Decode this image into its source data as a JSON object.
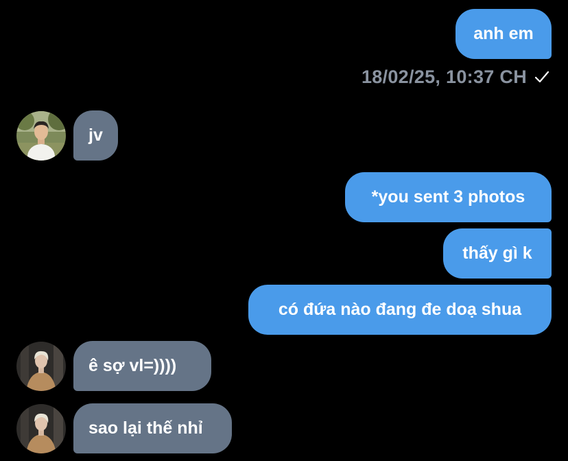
{
  "thread": {
    "messages": [
      {
        "id": "m1",
        "direction": "sent",
        "text": "anh em"
      },
      {
        "id": "m2",
        "direction": "received",
        "text": "jv"
      },
      {
        "id": "m3",
        "direction": "sent",
        "text": "*you sent 3 photos"
      },
      {
        "id": "m4",
        "direction": "sent",
        "text": "thấy gì k"
      },
      {
        "id": "m5",
        "direction": "sent",
        "text": "có đứa nào đang đe doạ shua"
      },
      {
        "id": "m6",
        "direction": "received",
        "text": "ê sợ vl=))))"
      },
      {
        "id": "m7",
        "direction": "received",
        "text": "sao lại thế nhỉ"
      }
    ],
    "timestamp": "18/02/25, 10:37 CH",
    "read_status_icon": "checkmark-icon"
  },
  "colors": {
    "background": "#000000",
    "sent_bubble": "#4a9bea",
    "received_bubble": "#657487",
    "timestamp": "#8a93a0"
  }
}
